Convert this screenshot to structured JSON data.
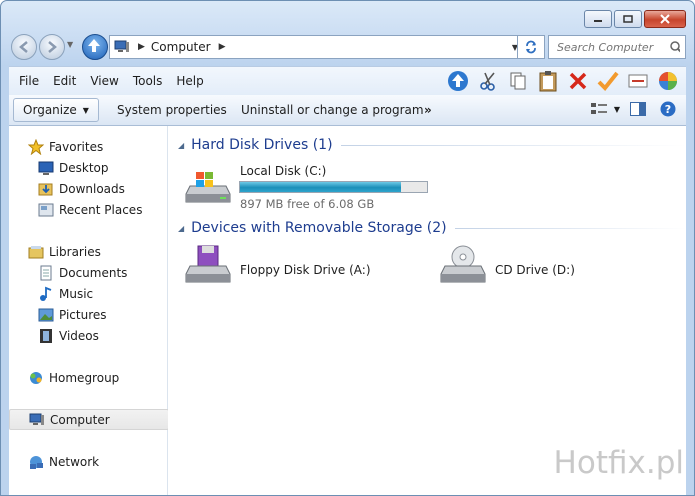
{
  "address": {
    "location": "Computer"
  },
  "search": {
    "placeholder": "Search Computer"
  },
  "menu": [
    "File",
    "Edit",
    "View",
    "Tools",
    "Help"
  ],
  "toolbar_icons": [
    "up-icon",
    "cut-icon",
    "copy-icon",
    "paste-icon",
    "delete-icon",
    "checkmark-icon",
    "rename-icon",
    "properties-icon"
  ],
  "cmdbar": {
    "organize": "Organize",
    "system_properties": "System properties",
    "uninstall": "Uninstall or change a program",
    "more": "»"
  },
  "nav": {
    "favorites": "Favorites",
    "desktop": "Desktop",
    "downloads": "Downloads",
    "recent": "Recent Places",
    "libraries": "Libraries",
    "documents": "Documents",
    "music": "Music",
    "pictures": "Pictures",
    "videos": "Videos",
    "homegroup": "Homegroup",
    "computer": "Computer",
    "network": "Network"
  },
  "groups": {
    "hdd": "Hard Disk Drives (1)",
    "removable": "Devices with Removable Storage (2)"
  },
  "drives": {
    "local": {
      "name": "Local Disk (C:)",
      "free": "897 MB free of 6.08 GB",
      "used_fraction": 0.86
    },
    "floppy": {
      "name": "Floppy Disk Drive (A:)"
    },
    "cd": {
      "name": "CD Drive (D:)"
    }
  },
  "watermark": "Hotfix.pl"
}
